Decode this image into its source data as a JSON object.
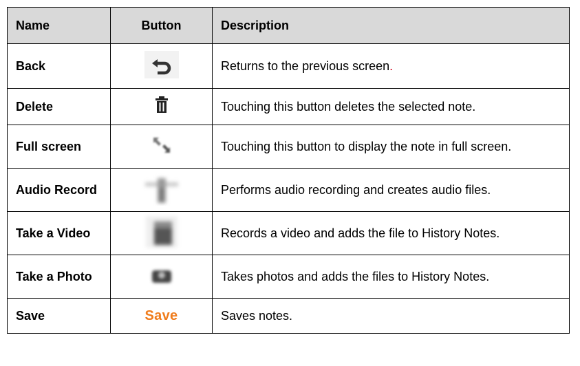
{
  "table": {
    "headers": {
      "name": "Name",
      "button": "Button",
      "description": "Description"
    },
    "rows": [
      {
        "name": "Back",
        "icon": "back-arrow-icon",
        "description": "Returns to the previous screen",
        "description_suffix": "."
      },
      {
        "name": "Delete",
        "icon": "trash-icon",
        "description": "Touching this button deletes the selected note."
      },
      {
        "name": "Full screen",
        "icon": "fullscreen-icon",
        "description": "Touching this button to display the note in full screen."
      },
      {
        "name": "Audio Record",
        "icon": "microphone-icon",
        "description": "Performs audio recording and creates audio files."
      },
      {
        "name": "Take a Video",
        "icon": "video-camera-icon",
        "description": "Records a video and adds the file to History Notes."
      },
      {
        "name": "Take a Photo",
        "icon": "camera-icon",
        "description": "Takes photos and adds the files to History Notes."
      },
      {
        "name": "Save",
        "icon": "save-text-button",
        "button_text": "Save",
        "description": "Saves notes."
      }
    ]
  },
  "colors": {
    "header_bg": "#d9d9d9",
    "save_text": "#f07c1c",
    "icon_dark": "#333333"
  }
}
